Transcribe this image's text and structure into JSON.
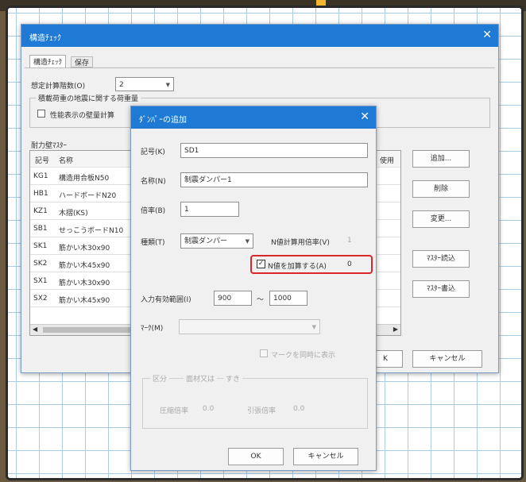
{
  "main_window": {
    "title": "構造ﾁｪｯｸ",
    "close_glyph": "✕",
    "tabs": [
      "構造ﾁｪｯｸ",
      "保存"
    ],
    "design_zone_label": "想定計算階数(O)",
    "design_zone_value": "2",
    "section_label": "積載荷重の地震に関する荷重量",
    "checkbox_label": "性能表示の壁量計算",
    "master_label": "耐力壁ﾏｽﾀｰ",
    "columns": {
      "code": "記号",
      "name": "名称",
      "use": "使用"
    },
    "rows": [
      {
        "code": "KG1",
        "name": "構造用合板N50"
      },
      {
        "code": "HB1",
        "name": "ハードボードN20"
      },
      {
        "code": "KZ1",
        "name": "木摺(KS)"
      },
      {
        "code": "SB1",
        "name": "せっこうボードN10"
      },
      {
        "code": "SK1",
        "name": "筋かい木30x90"
      },
      {
        "code": "SK2",
        "name": "筋かい木45x90"
      },
      {
        "code": "SX1",
        "name": "筋かい木30x90"
      },
      {
        "code": "SX2",
        "name": "筋かい木45x90"
      }
    ],
    "side_buttons": [
      "追加...",
      "削除",
      "変更...",
      "ﾏｽﾀｰ読込",
      "ﾏｽﾀｰ書込"
    ],
    "cancel_button": "キャンセル",
    "ok_button_partial": "K"
  },
  "dialog": {
    "title": "ﾀﾞﾝﾊﾟｰの追加",
    "close_glyph": "✕",
    "code_label": "記号(K)",
    "code_value": "SD1",
    "name_label": "名称(N)",
    "name_value": "制震ダンパー1",
    "multiplier_label": "倍率(B)",
    "multiplier_value": "1",
    "type_label": "種類(T)",
    "type_value": "制震ダンパー",
    "n_calc_label": "N値計算用倍率(V)",
    "n_calc_value": "1",
    "n_add_label": "N値を加算する(A)",
    "n_add_checked": true,
    "n_add_value": "0",
    "range_label": "入力有効範囲(I)",
    "range_min": "900",
    "range_sep": "～",
    "range_max": "1000",
    "mark_label": "ﾏｰｸ(M)",
    "mark_same_label": "マークを同時に表示",
    "group_label": "区分",
    "group_value": "面材又は",
    "group_value2": "すき",
    "compression_label": "圧縮倍率",
    "compression_value": "0.0",
    "tension_label": "引張倍率",
    "tension_value": "0.0",
    "ok_button": "OK",
    "cancel_button": "キャンセル"
  },
  "colors": {
    "titlebar": "#1f7ad6",
    "highlight": "#d9262b",
    "grid": "#a9cbe3"
  }
}
